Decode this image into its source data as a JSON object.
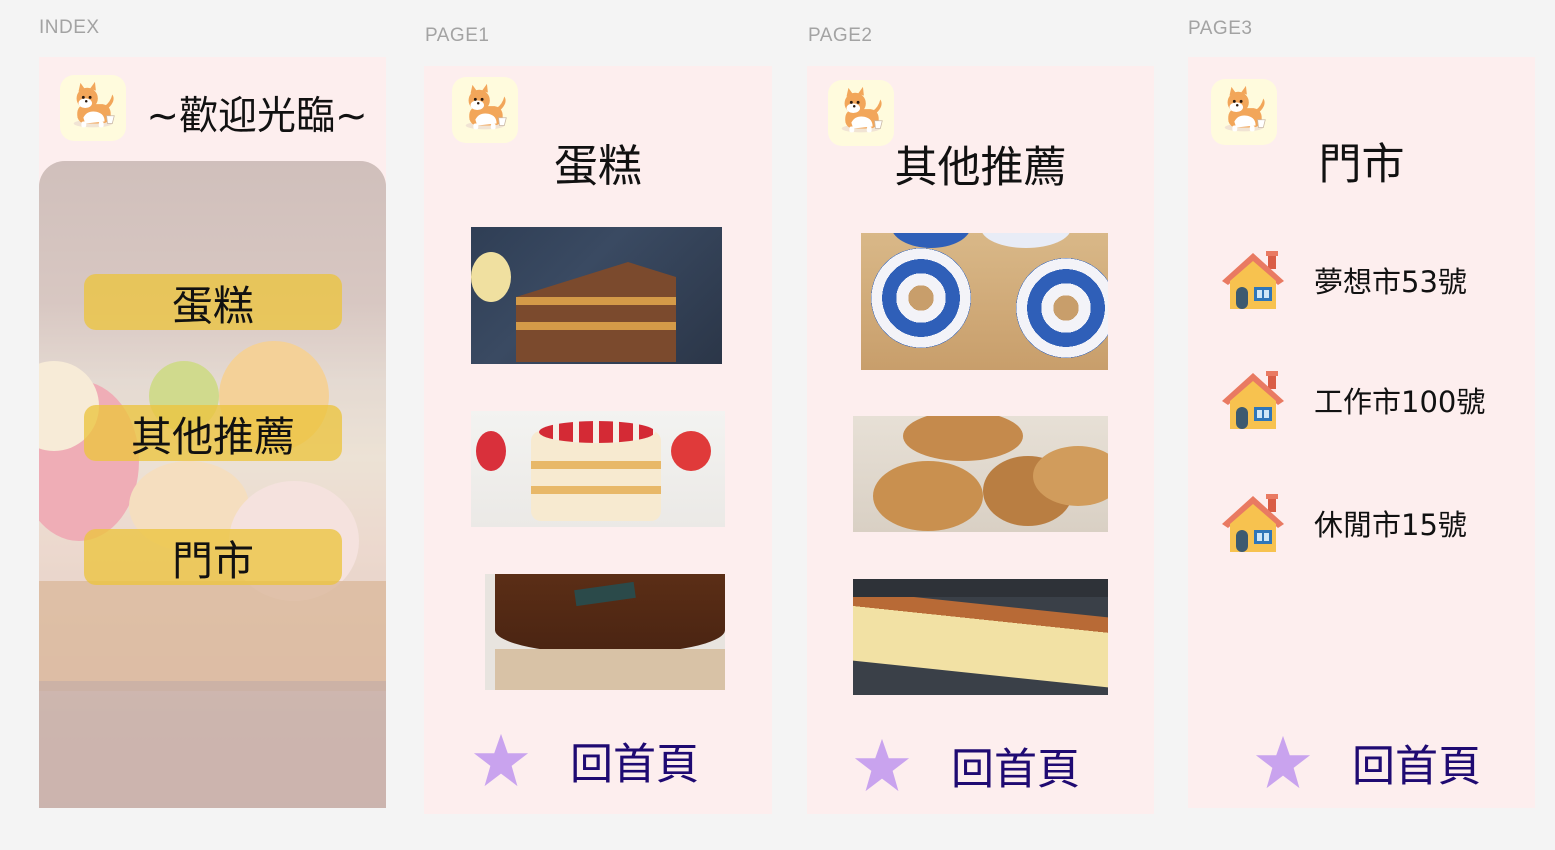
{
  "frames": {
    "index": {
      "label": "INDEX",
      "title": "~歡迎光臨~",
      "menu": [
        "蛋糕",
        "其他推薦",
        "門市"
      ]
    },
    "page1": {
      "label": "PAGE1",
      "title": "蛋糕",
      "images": [
        "banana-chocolate-crepe-cake",
        "strawberry-cream-cake",
        "chocolate-mousse-cake"
      ],
      "home": "回首頁"
    },
    "page2": {
      "label": "PAGE2",
      "title": "其他推薦",
      "images": [
        "blue-porcelain-donuts",
        "chocolate-chip-cookies",
        "castella-sponge-cake"
      ],
      "home": "回首頁"
    },
    "page3": {
      "label": "PAGE3",
      "title": "門市",
      "stores": [
        "夢想市53號",
        "工作市100號",
        "休閒市15號"
      ],
      "home": "回首頁"
    }
  },
  "icons": {
    "logo": "shiba-dog-icon",
    "home": "star-icon",
    "store": "house-icon"
  },
  "colors": {
    "frame_bg": "#fdeeee",
    "menu_button": "#ecc43f",
    "star": "#c9a3ee",
    "home_text": "#1f0a72"
  }
}
